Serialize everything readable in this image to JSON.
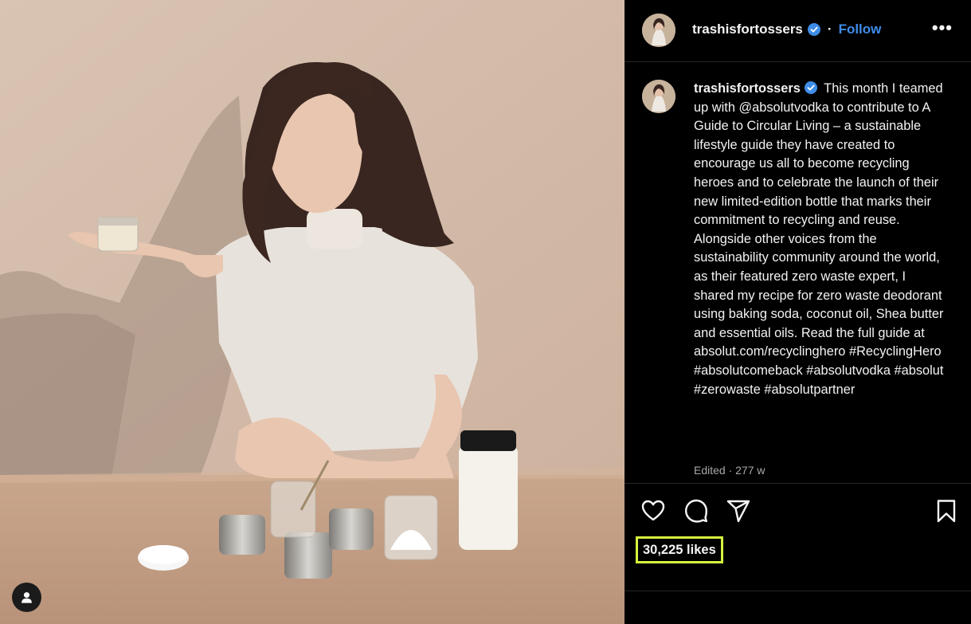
{
  "post": {
    "username": "trashisfortossers",
    "header_separator": "·",
    "follow_label": "Follow",
    "more_label": "•••",
    "caption_text": "This month I teamed up with @absolutvodka to contribute to A Guide to Circular Living – a sustainable lifestyle guide they have created to encourage us all to become recycling heroes and to celebrate the launch of their new limited-edition bottle that marks their commitment to recycling and reuse. Alongside other voices from the sustainability community around the world, as their featured zero waste expert, I shared my recipe for zero waste deodorant using baking soda, coconut oil, Shea butter and essential oils. Read the full guide at absolut.com/recyclinghero #RecyclingHero #absolutcomeback #absolutvodka #absolut #zerowaste #absolutpartner",
    "edited_label": "Edited · 277 w",
    "likes_label": "30,225 likes"
  },
  "icons": {
    "verified": "verified-badge-icon",
    "like": "heart-icon",
    "comment": "comment-icon",
    "share": "paper-plane-icon",
    "save": "bookmark-icon",
    "user_tag": "user-icon"
  },
  "colors": {
    "accent": "#3f8ce8",
    "highlight": "#d7f23d",
    "background": "#000000",
    "muted_text": "#a8a8a8"
  }
}
